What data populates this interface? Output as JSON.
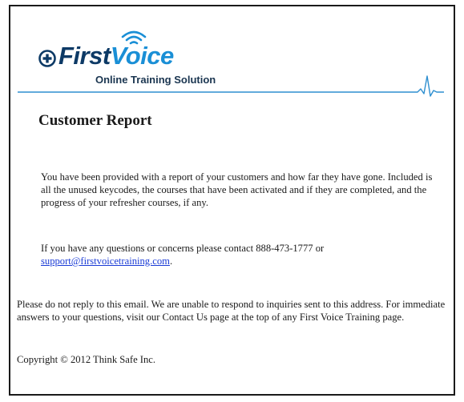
{
  "brand": {
    "name_first": "First",
    "name_second": "Voice",
    "tagline": "Online Training Solution",
    "color_dark": "#0d3a66",
    "color_light": "#1a8fd6",
    "icons": [
      "plus-badge-icon",
      "wifi-signal-icon",
      "heartbeat-pulse-icon"
    ]
  },
  "email": {
    "title": "Customer Report",
    "intro": "You have been provided with a report of your customers and how far they have gone. Included is all the unused keycodes, the courses that have been activated and if they are completed, and the progress of your refresher courses, if any.",
    "contact_prefix": "If you have any questions or concerns please contact 888-473-1777 or",
    "contact_link": "support@firstvoicetraining.com",
    "contact_suffix": ".",
    "notice": "Please do not reply to this email. We are unable to respond to inquiries sent to this address. For immediate answers to your questions, visit our Contact Us page at the top of any First Voice Training page.",
    "copyright": "Copyright © 2012 Think Safe Inc."
  },
  "colors": {
    "link": "#1a3bd6",
    "rule": "#2e8fd0"
  }
}
